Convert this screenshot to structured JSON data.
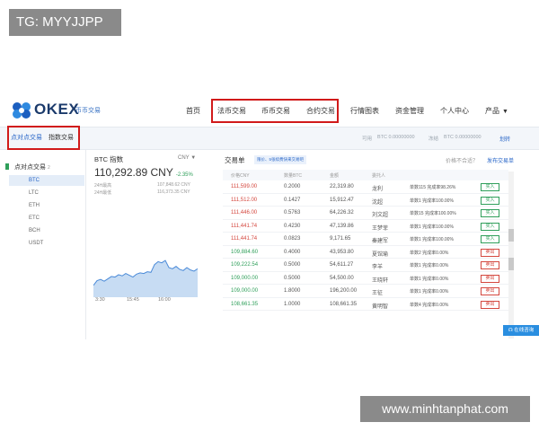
{
  "overlay": {
    "tg_label": "TG: MYYJJPP",
    "watermark": "www.minhtanphat.com"
  },
  "header": {
    "brand": "OKEX",
    "brand_sub": "币币交易",
    "nav": [
      "首页",
      "法币交易",
      "币币交易",
      "合约交易",
      "行情图表",
      "资金管理",
      "个人中心",
      "产品"
    ]
  },
  "tabs": [
    "点对点交易",
    "指数交易"
  ],
  "account": {
    "available_label": "可用",
    "available_value": "BTC 0.00000000",
    "frozen_label": "冻结",
    "frozen_value": "BTC 0.00000000",
    "transfer": "划转"
  },
  "sidebar": {
    "heading": "点对点交易",
    "count": "2",
    "coins": [
      "BTC",
      "LTC",
      "ETH",
      "ETC",
      "BCH",
      "USDT"
    ]
  },
  "index_panel": {
    "title": "BTC 指数",
    "currency": "CNY",
    "price": "110,292.89 CNY",
    "change": "-2.35%",
    "stats": [
      {
        "label": "24H最高",
        "value": "107,848.62 CNY"
      },
      {
        "label": "24H最低",
        "value": "116,373.35 CNY"
      }
    ],
    "chart_ticks": [
      "3:30",
      "15:45",
      "16:00"
    ],
    "chart_points": [
      0.2,
      0.28,
      0.3,
      0.27,
      0.31,
      0.35,
      0.34,
      0.38,
      0.36,
      0.4,
      0.37,
      0.34,
      0.39,
      0.41,
      0.4,
      0.43,
      0.42,
      0.55,
      0.6,
      0.58,
      0.62,
      0.5,
      0.48,
      0.52,
      0.47,
      0.45,
      0.5,
      0.46,
      0.44,
      0.48
    ]
  },
  "trade_table": {
    "title": "交易单",
    "tip": "限价、5张续费快来交易吧",
    "right_text": "价格不合适？",
    "right_link": "发布交易单",
    "headers": [
      "价格CNY",
      "数量BTC",
      "金额",
      "委托人"
    ],
    "rows": [
      {
        "price": "111,599.00",
        "amount": "0.2000",
        "total": "22,319.80",
        "user": "龙利",
        "stats": "单数115  完成率98.26%",
        "action": "买入",
        "side": "buy"
      },
      {
        "price": "111,512.00",
        "amount": "0.1427",
        "total": "15,912.47",
        "user": "沈超",
        "stats": "单数1  完成率100.00%",
        "action": "买入",
        "side": "buy"
      },
      {
        "price": "111,446.00",
        "amount": "0.5763",
        "total": "64,226.32",
        "user": "刘文超",
        "stats": "单数15  完成率100.00%",
        "action": "买入",
        "side": "buy"
      },
      {
        "price": "111,441.74",
        "amount": "0.4230",
        "total": "47,139.86",
        "user": "王梦菲",
        "stats": "单数1  完成率100.00%",
        "action": "买入",
        "side": "buy"
      },
      {
        "price": "111,441.74",
        "amount": "0.0823",
        "total": "9,171.65",
        "user": "秦建军",
        "stats": "单数1  完成率100.00%",
        "action": "买入",
        "side": "buy"
      },
      {
        "price": "109,884.60",
        "amount": "0.4000",
        "total": "43,953.80",
        "user": "夏馆瑜",
        "stats": "单数2  完成率0.00%",
        "action": "卖出",
        "side": "sell"
      },
      {
        "price": "109,222.54",
        "amount": "0.5000",
        "total": "54,611.27",
        "user": "李羊",
        "stats": "单数1  完成率0.00%",
        "action": "卖出",
        "side": "sell"
      },
      {
        "price": "109,000.00",
        "amount": "0.5000",
        "total": "54,500.00",
        "user": "王晓轩",
        "stats": "单数1  完成率0.00%",
        "action": "卖出",
        "side": "sell"
      },
      {
        "price": "109,000.00",
        "amount": "1.8000",
        "total": "196,200.00",
        "user": "王征",
        "stats": "单数1  完成率0.00%",
        "action": "卖出",
        "side": "sell"
      },
      {
        "price": "108,661.35",
        "amount": "1.0000",
        "total": "108,661.35",
        "user": "黄明智",
        "stats": "单数4  完成率0.00%",
        "action": "卖出",
        "side": "sell"
      }
    ]
  },
  "online_service": "在线咨询",
  "colors": {
    "brand_blue": "#2a67c8",
    "up_red": "#d4473e",
    "down_green": "#2f9f5a",
    "highlight_red": "#d11a1a"
  }
}
